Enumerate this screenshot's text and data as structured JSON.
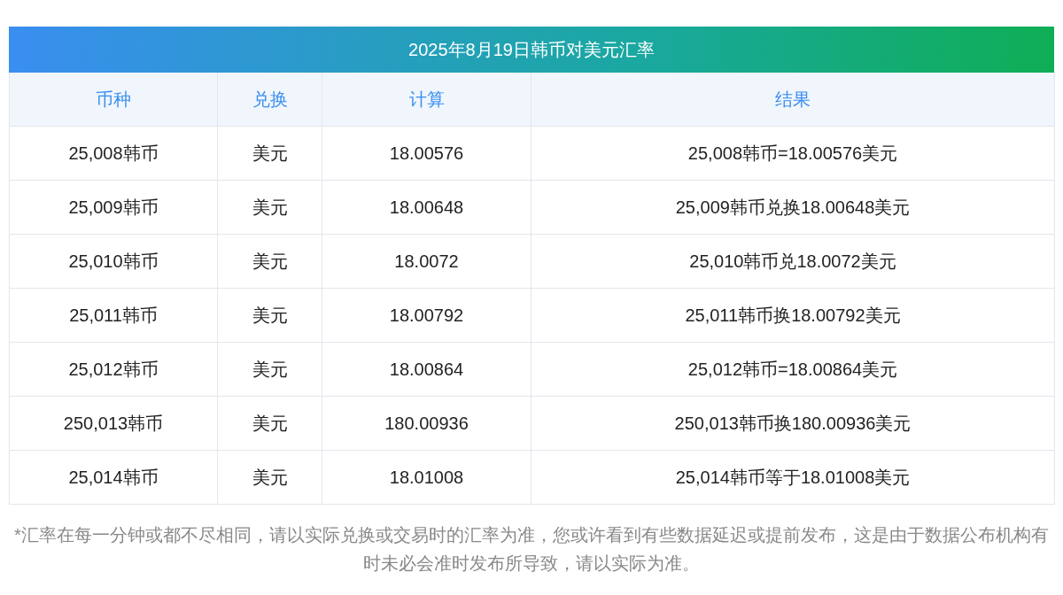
{
  "table": {
    "title": "2025年8月19日韩币对美元汇率",
    "columns": [
      "币种",
      "兑换",
      "计算",
      "结果"
    ],
    "rows": [
      [
        "25,008韩币",
        "美元",
        "18.00576",
        "25,008韩币=18.00576美元"
      ],
      [
        "25,009韩币",
        "美元",
        "18.00648",
        "25,009韩币兑换18.00648美元"
      ],
      [
        "25,010韩币",
        "美元",
        "18.0072",
        "25,010韩币兑18.0072美元"
      ],
      [
        "25,011韩币",
        "美元",
        "18.00792",
        "25,011韩币换18.00792美元"
      ],
      [
        "25,012韩币",
        "美元",
        "18.00864",
        "25,012韩币=18.00864美元"
      ],
      [
        "250,013韩币",
        "美元",
        "180.00936",
        "250,013韩币换180.00936美元"
      ],
      [
        "25,014韩币",
        "美元",
        "18.01008",
        "25,014韩币等于18.01008美元"
      ]
    ]
  },
  "note": "*汇率在每一分钟或都不尽相同，请以实际兑换或交易时的汇率为准，您或许看到有些数据延迟或提前发布，这是由于数据公布机构有时未必会准时发布所导致，请以实际为准。"
}
